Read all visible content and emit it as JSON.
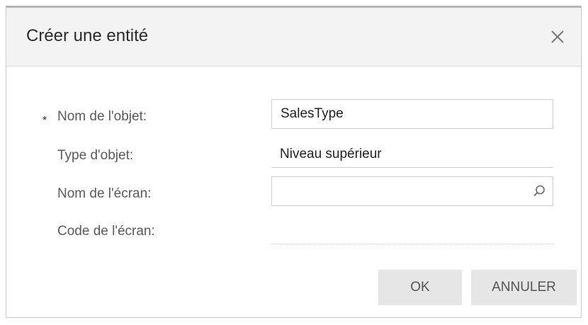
{
  "dialog": {
    "title": "Créer une entité",
    "close_icon": "close-icon"
  },
  "form": {
    "required_marker": "*",
    "object_name": {
      "label": "Nom de l'objet:",
      "value": "SalesType",
      "required": true
    },
    "object_type": {
      "label": "Type d'objet:",
      "value": "Niveau supérieur"
    },
    "screen_name": {
      "label": "Nom de l'écran:",
      "value": "",
      "icon": "search-icon"
    },
    "screen_code": {
      "label": "Code de l'écran:",
      "value": ""
    }
  },
  "buttons": {
    "ok": "OK",
    "cancel": "ANNULER"
  }
}
